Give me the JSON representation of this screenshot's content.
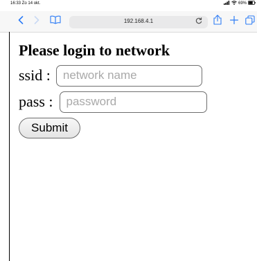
{
  "status_bar": {
    "time_date": "16:33  Zo 14 okt.",
    "battery": "69%",
    "icons": [
      "signal-icon",
      "wifi-icon",
      "battery-icon"
    ]
  },
  "toolbar": {
    "url": "192.168.4.1",
    "icons": [
      "back-icon",
      "forward-icon",
      "bookmarks-icon",
      "reload-icon",
      "share-icon",
      "new-tab-icon",
      "tabs-icon"
    ]
  },
  "page": {
    "heading": "Please login to network",
    "ssid_label": "ssid :",
    "ssid_placeholder": "network name",
    "ssid_value": "",
    "pass_label": "pass :",
    "pass_placeholder": "password",
    "pass_value": "",
    "submit_label": "Submit"
  },
  "colors": {
    "accent": "#2d7cf6",
    "toolbar_bg": "#f7f7f7",
    "url_bar_bg": "#e9e9ea"
  }
}
